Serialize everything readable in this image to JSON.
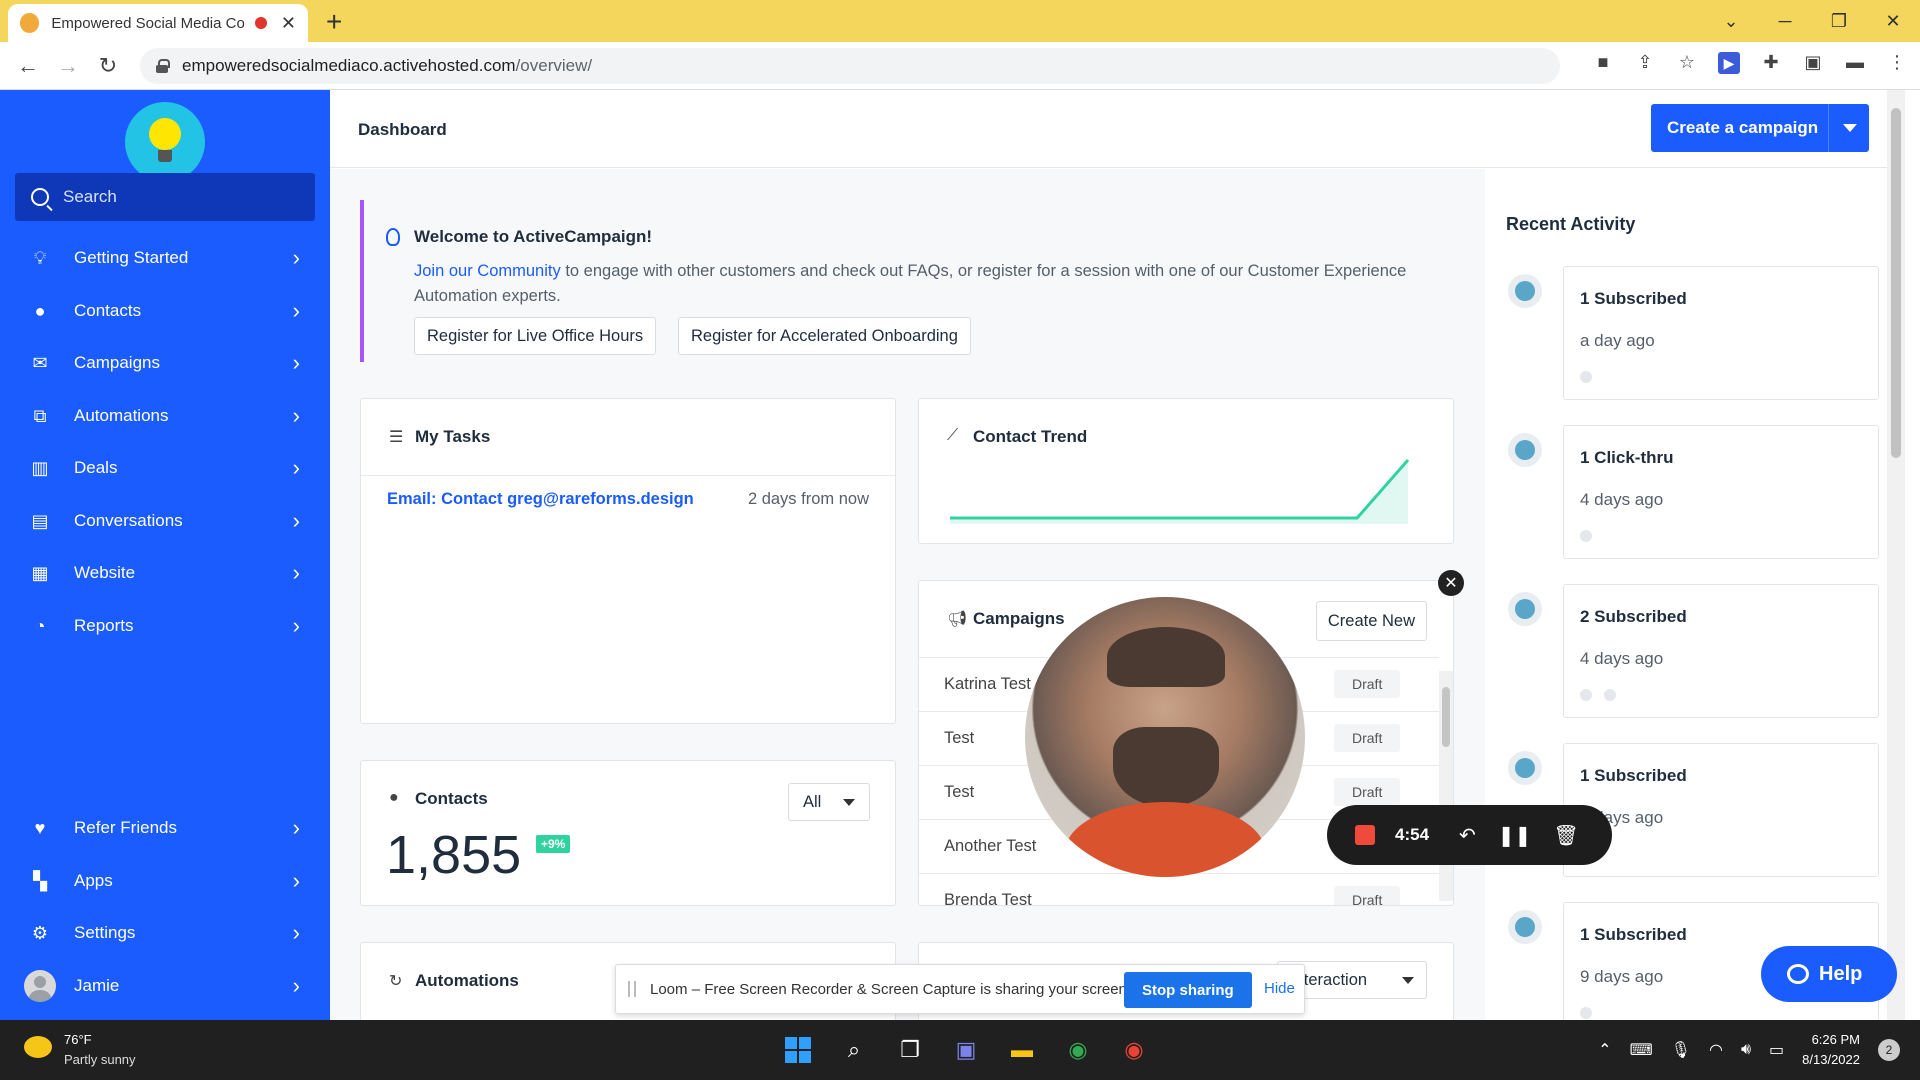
{
  "browser": {
    "tab_title": "Empowered Social Media Co",
    "url_host": "empoweredsocialmediaco.activehosted.com",
    "url_path": "/overview/"
  },
  "sidebar": {
    "search_placeholder": "Search",
    "items": [
      {
        "label": "Getting Started",
        "icon": "lightbulb-icon"
      },
      {
        "label": "Contacts",
        "icon": "person-icon"
      },
      {
        "label": "Campaigns",
        "icon": "envelope-icon"
      },
      {
        "label": "Automations",
        "icon": "automation-icon"
      },
      {
        "label": "Deals",
        "icon": "pipeline-icon"
      },
      {
        "label": "Conversations",
        "icon": "chat-icon"
      },
      {
        "label": "Website",
        "icon": "website-icon"
      },
      {
        "label": "Reports",
        "icon": "pie-chart-icon"
      }
    ],
    "bottom_items": [
      {
        "label": "Refer Friends",
        "icon": "heart-icon"
      },
      {
        "label": "Apps",
        "icon": "apps-icon"
      },
      {
        "label": "Settings",
        "icon": "gear-icon"
      },
      {
        "label": "Jamie",
        "icon": "avatar"
      }
    ]
  },
  "header": {
    "title": "Dashboard",
    "create_campaign": "Create a campaign"
  },
  "welcome": {
    "title": "Welcome to ActiveCampaign!",
    "link_text": "Join our Community",
    "body_text": " to engage with other customers and check out FAQs, or register for a session with one of our Customer Experience Automation experts.",
    "button_live_hours": "Register for Live Office Hours",
    "button_onboarding": "Register for Accelerated Onboarding"
  },
  "tasks": {
    "title": "My Tasks",
    "task_link": "Email: Contact greg@rareforms.design",
    "task_due": "2 days from now"
  },
  "contact_trend": {
    "title": "Contact Trend"
  },
  "chart_data": {
    "type": "line",
    "title": "Contact Trend",
    "series": [
      {
        "values": [
          0,
          0,
          0,
          0,
          0,
          0,
          0,
          0,
          0,
          1
        ]
      }
    ],
    "grid": false,
    "color": "#2fd3a0"
  },
  "contacts": {
    "title": "Contacts",
    "count": "1,855",
    "badge": "+9%",
    "filter_value": "All"
  },
  "campaigns": {
    "title": "Campaigns",
    "create_new": "Create New",
    "rows": [
      {
        "name": "Katrina Test",
        "status": "Draft"
      },
      {
        "name": "Test",
        "status": "Draft"
      },
      {
        "name": "Test",
        "status": "Draft"
      },
      {
        "name": "Another Test",
        "status": "Draft"
      },
      {
        "name": "Brenda Test",
        "status": "Draft"
      }
    ]
  },
  "automations": {
    "title": "Automations",
    "filter_value": "Interaction"
  },
  "activity": {
    "title": "Recent Activity",
    "items": [
      {
        "head": "1 Subscribed",
        "time": "a day ago",
        "people": 1
      },
      {
        "head": "1 Click-thru",
        "time": "4 days ago",
        "people": 1
      },
      {
        "head": "2 Subscribed",
        "time": "4 days ago",
        "people": 2
      },
      {
        "head": "1 Subscribed",
        "time": "4 days ago",
        "people": 1
      },
      {
        "head": "1 Subscribed",
        "time": "9 days ago",
        "people": 1
      }
    ]
  },
  "loom": {
    "timer": "4:54",
    "share_text": "Loom – Free Screen Recorder & Screen Capture is sharing your screen.",
    "stop_sharing": "Stop sharing",
    "hide": "Hide"
  },
  "help": {
    "label": "Help"
  },
  "taskbar": {
    "temp": "76°F",
    "weather": "Partly sunny",
    "time": "6:26 PM",
    "date": "8/13/2022",
    "notifications": "2"
  }
}
